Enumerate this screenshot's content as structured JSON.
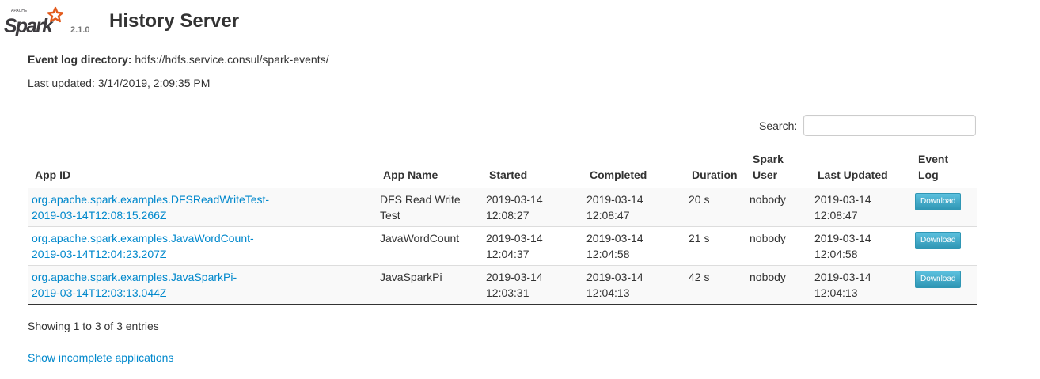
{
  "header": {
    "logo_text": "Spark",
    "logo_apache": "APACHE",
    "version": "2.1.0",
    "title": "History Server"
  },
  "info": {
    "event_log_label": "Event log directory:",
    "event_log_value": "hdfs://hdfs.service.consul/spark-events/",
    "last_updated": "Last updated: 3/14/2019, 2:09:35 PM"
  },
  "search": {
    "label": "Search:",
    "value": ""
  },
  "table": {
    "headers": {
      "app_id": "App ID",
      "app_name": "App Name",
      "started": "Started",
      "completed": "Completed",
      "duration": "Duration",
      "spark_user_1": "Spark",
      "spark_user_2": "User",
      "last_updated": "Last Updated",
      "event_log_1": "Event",
      "event_log_2": "Log"
    },
    "rows": [
      {
        "app_id_1": "org.apache.spark.examples.DFSReadWriteTest-",
        "app_id_2": "2019-03-14T12:08:15.266Z",
        "app_name_1": "DFS Read Write",
        "app_name_2": "Test",
        "started_1": "2019-03-14",
        "started_2": "12:08:27",
        "completed_1": "2019-03-14",
        "completed_2": "12:08:47",
        "duration": "20 s",
        "user": "nobody",
        "last_updated_1": "2019-03-14",
        "last_updated_2": "12:08:47",
        "download": "Download"
      },
      {
        "app_id_1": "org.apache.spark.examples.JavaWordCount-",
        "app_id_2": "2019-03-14T12:04:23.207Z",
        "app_name_1": "JavaWordCount",
        "app_name_2": "",
        "started_1": "2019-03-14",
        "started_2": "12:04:37",
        "completed_1": "2019-03-14",
        "completed_2": "12:04:58",
        "duration": "21 s",
        "user": "nobody",
        "last_updated_1": "2019-03-14",
        "last_updated_2": "12:04:58",
        "download": "Download"
      },
      {
        "app_id_1": "org.apache.spark.examples.JavaSparkPi-",
        "app_id_2": "2019-03-14T12:03:13.044Z",
        "app_name_1": "JavaSparkPi",
        "app_name_2": "",
        "started_1": "2019-03-14",
        "started_2": "12:03:31",
        "completed_1": "2019-03-14",
        "completed_2": "12:04:13",
        "duration": "42 s",
        "user": "nobody",
        "last_updated_1": "2019-03-14",
        "last_updated_2": "12:04:13",
        "download": "Download"
      }
    ]
  },
  "footer": {
    "entries": "Showing 1 to 3 of 3 entries",
    "incomplete_link": "Show incomplete applications"
  },
  "colors": {
    "link": "#0088cc",
    "logo_orange": "#e25a1c",
    "logo_gray": "#3c3a3e",
    "button": "#2f96b4"
  }
}
